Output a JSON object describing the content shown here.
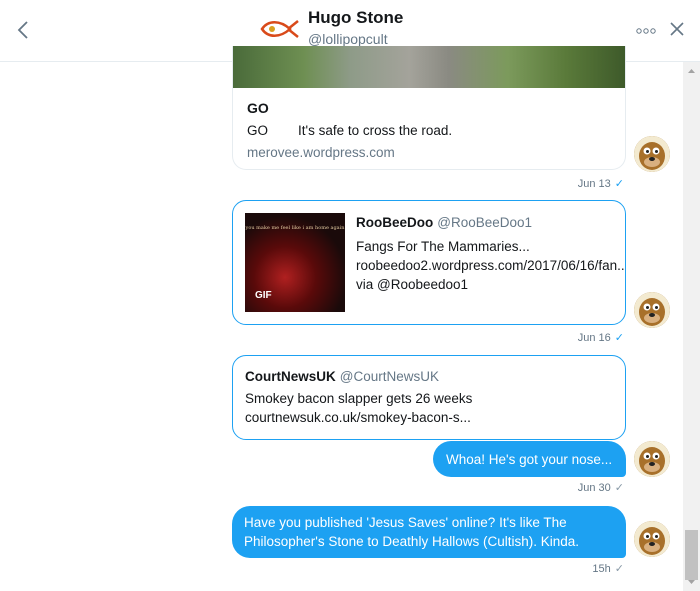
{
  "header": {
    "name": "Hugo Stone",
    "handle": "@lollipopcult"
  },
  "messages": {
    "go_card": {
      "title": "GO",
      "description": "GO        It's safe to cross the road.",
      "link": "merovee.wordpress.com",
      "timestamp": "Jun 13"
    },
    "roobeedoo_card": {
      "name": "RooBeeDoo",
      "handle": "@RooBeeDoo1",
      "text": "Fangs For The Mammaries... roobeedoo2.wordpress.com/2017/06/16/fan... via @Roobeedoo1",
      "thumb_caption": "you make me feel like i am home again",
      "gif_badge": "GIF",
      "timestamp": "Jun 16"
    },
    "courtnews_card": {
      "name": "CourtNewsUK",
      "handle": "@CourtNewsUK",
      "text": "Smokey bacon slapper gets 26 weeks courtnewsuk.co.uk/smokey-bacon-s..."
    },
    "bubble_1": {
      "text": "Whoa! He's got your nose...",
      "timestamp": "Jun 30"
    },
    "bubble_2": {
      "text": "Have you published 'Jesus Saves' online? It's like The Philosopher's Stone to Deathly Hallows (Cultish). Kinda.",
      "timestamp": "15h"
    }
  },
  "icons": {
    "back": "chevron-left-icon",
    "more": "more-dots-icon",
    "close": "close-icon",
    "read_receipt": "check-icon"
  },
  "colors": {
    "accent": "#1da1f2",
    "secondary_text": "#657786",
    "border": "#e6ecf0"
  }
}
